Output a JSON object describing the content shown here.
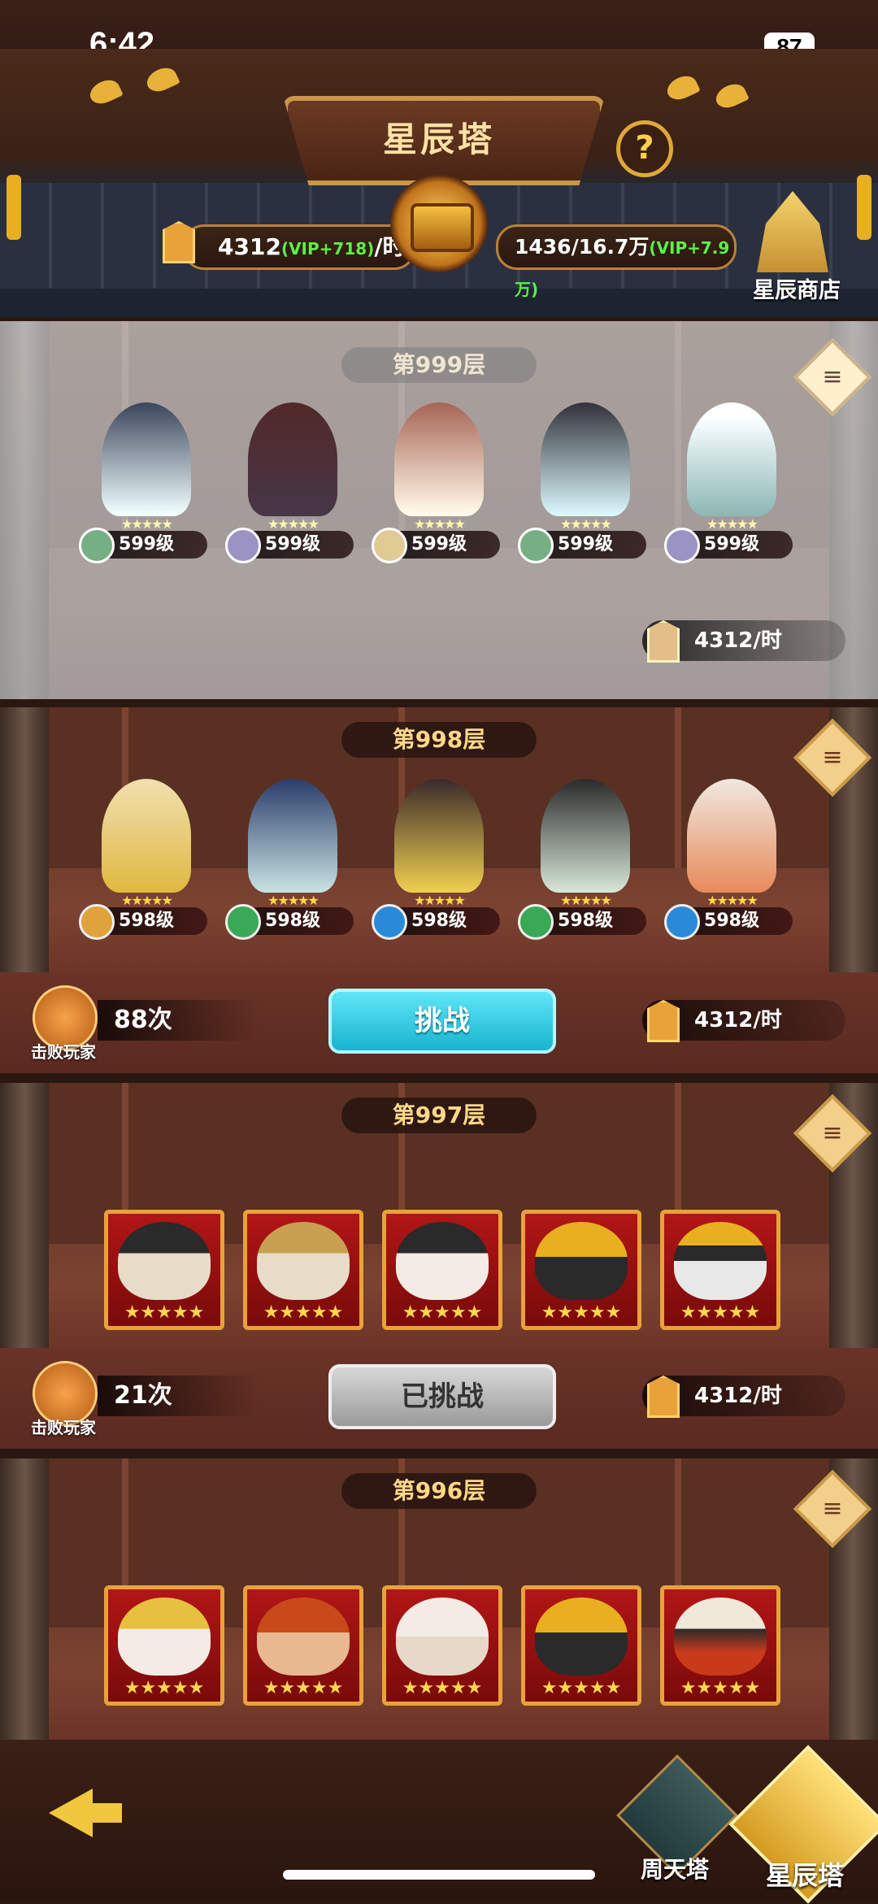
{
  "status_bar": {
    "time": "6:42",
    "battery": "87"
  },
  "header": {
    "title": "星辰塔",
    "help_label": "?",
    "rate_value": "4312",
    "rate_vip": "(VIP+718)",
    "rate_unit": "/时",
    "storage_value": "1436/16.7万",
    "storage_vip": "(VIP+7.9万)",
    "shop_label": "星辰商店"
  },
  "floors": [
    {
      "label": "第999层",
      "heroes": [
        {
          "level": "599级",
          "element": "#3aa856"
        },
        {
          "level": "599级",
          "element": "#8a7ad8"
        },
        {
          "level": "599级",
          "element": "#d8b048"
        },
        {
          "level": "599级",
          "element": "#3aa856"
        },
        {
          "level": "599级",
          "element": "#8a7ad8"
        }
      ],
      "rate": "4312/时"
    },
    {
      "label": "第998层",
      "heroes": [
        {
          "level": "598级",
          "element": "#e0a23a"
        },
        {
          "level": "598级",
          "element": "#3aa856"
        },
        {
          "level": "598级",
          "element": "#2a8ad8"
        },
        {
          "level": "598级",
          "element": "#3aa856"
        },
        {
          "level": "598级",
          "element": "#2a8ad8"
        }
      ],
      "defeat_label": "击败玩家",
      "count": "88次",
      "button": "挑战",
      "rate": "4312/时"
    },
    {
      "label": "第997层",
      "stars": "★★★★★",
      "defeat_label": "击败玩家",
      "count": "21次",
      "button": "已挑战",
      "rate": "4312/时"
    },
    {
      "label": "第996层",
      "stars": "★★★★★"
    }
  ],
  "hero_stars": "★★★★★",
  "doc_icon": "≡",
  "bottom_nav": {
    "tower1": "周天塔",
    "tower2": "星辰塔"
  },
  "colors": {
    "challenge": "#18b4d0",
    "challenged": "#9a9a9a",
    "gold": "#ffd88a"
  }
}
